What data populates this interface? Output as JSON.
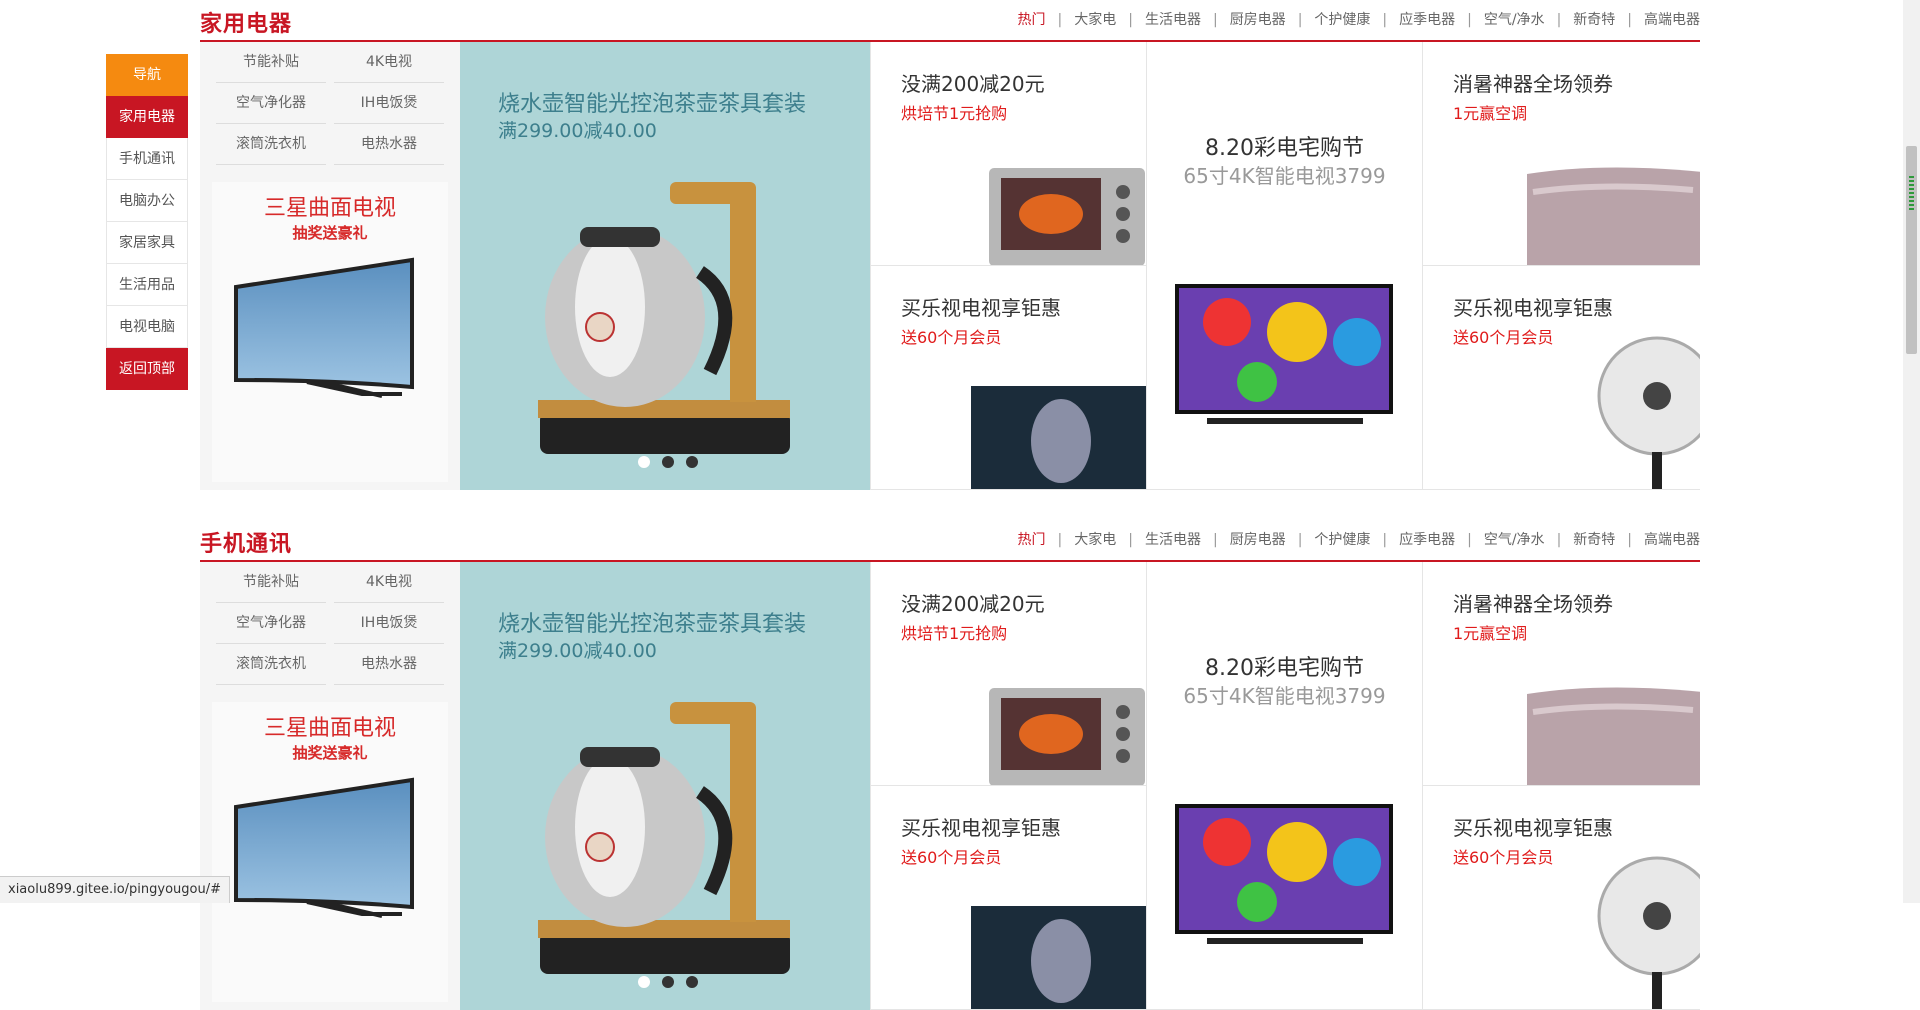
{
  "sidenav": {
    "items": [
      {
        "label": "导航"
      },
      {
        "label": "家用电器"
      },
      {
        "label": "手机通讯"
      },
      {
        "label": "电脑办公"
      },
      {
        "label": "家居家具"
      },
      {
        "label": "生活用品"
      },
      {
        "label": "电视电脑"
      },
      {
        "label": "返回顶部"
      }
    ]
  },
  "tabs": [
    "热门",
    "大家电",
    "生活电器",
    "厨房电器",
    "个护健康",
    "应季电器",
    "空气/净水",
    "新奇特",
    "高端电器"
  ],
  "sections": [
    {
      "title": "家用电器",
      "links": [
        "节能补贴",
        "4K电视",
        "空气净化器",
        "IH电饭煲",
        "滚筒洗衣机",
        "电热水器"
      ],
      "tv_promo": {
        "title": "三星曲面电视",
        "subtitle": "抽奖送豪礼"
      },
      "banner": {
        "title": "烧水壶智能光控泡茶壶茶具套装",
        "subtitle": "满299.00减40.00"
      },
      "cells": [
        {
          "title": "没满200减20元",
          "sub": "烘培节1元抢购"
        },
        {
          "title": "8.20彩电宅购节",
          "sub": "65寸4K智能电视3799"
        },
        {
          "title": "消暑神器全场领券",
          "sub": "1元赢空调"
        },
        {
          "title": "买乐视电视享钜惠",
          "sub": "送60个月会员"
        },
        {
          "title": "买乐视电视享钜惠",
          "sub": "送60个月会员"
        }
      ]
    },
    {
      "title": "手机通讯",
      "links": [
        "节能补贴",
        "4K电视",
        "空气净化器",
        "IH电饭煲",
        "滚筒洗衣机",
        "电热水器"
      ],
      "tv_promo": {
        "title": "三星曲面电视",
        "subtitle": "抽奖送豪礼"
      },
      "banner": {
        "title": "烧水壶智能光控泡茶壶茶具套装",
        "subtitle": "满299.00减40.00"
      },
      "cells": [
        {
          "title": "没满200减20元",
          "sub": "烘培节1元抢购"
        },
        {
          "title": "8.20彩电宅购节",
          "sub": "65寸4K智能电视3799"
        },
        {
          "title": "消暑神器全场领券",
          "sub": "1元赢空调"
        },
        {
          "title": "买乐视电视享钜惠",
          "sub": "送60个月会员"
        },
        {
          "title": "买乐视电视享钜惠",
          "sub": "送60个月会员"
        }
      ]
    }
  ],
  "statusbar": {
    "url": "xiaolu899.gitee.io/pingyougou/#"
  },
  "colors": {
    "brand": "#c81623",
    "nav_head": "#f58a10",
    "banner_bg": "#aed5d7"
  }
}
